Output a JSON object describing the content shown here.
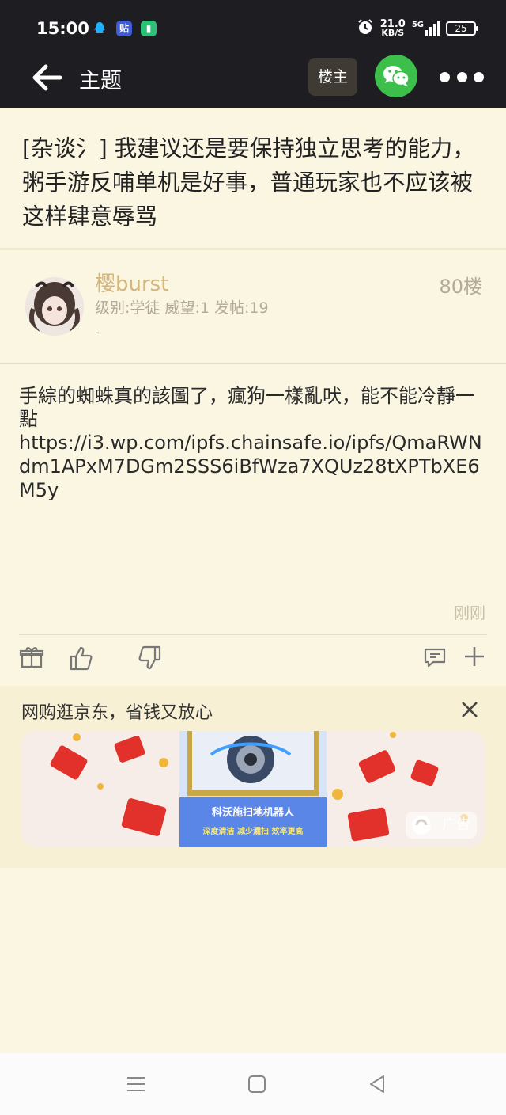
{
  "status_bar": {
    "time": "15:00",
    "net_speed": "21.0",
    "net_unit": "KB/S",
    "network": "5G",
    "battery": "25"
  },
  "nav": {
    "title": "主题",
    "op_button": "楼主"
  },
  "topic": {
    "title": "[杂谈氵] 我建议还是要保持独立思考的能力，粥手游反哺单机是好事，普通玩家也不应该被这样肆意辱骂"
  },
  "post": {
    "username": "樱burst",
    "meta": "级别:学徒 威望:1 发帖:19",
    "signature": "-",
    "floor": "80楼",
    "body_line1": "手綜的蜘蛛真的該圖了，瘋狗一樣亂吠，能不能冷靜一點",
    "body_url": "https://i3.wp.com/ipfs.chainsafe.io/ipfs/QmaRWNdm1APxM7DGm2SSS6iBfWza7XQUz28tXPTbXE6M5y",
    "time": "刚刚"
  },
  "ad": {
    "label": "网购逛京东，省钱又放心",
    "banner_title": "科沃施扫地机器人",
    "banner_sub": "深度清洁 减少漏扫 效率更高",
    "badge": "广告"
  },
  "colors": {
    "header_bg": "#1d1d22",
    "page_bg": "#fbf6e2",
    "username": "#d4b57a",
    "wechat_green": "#3dbf4c"
  }
}
